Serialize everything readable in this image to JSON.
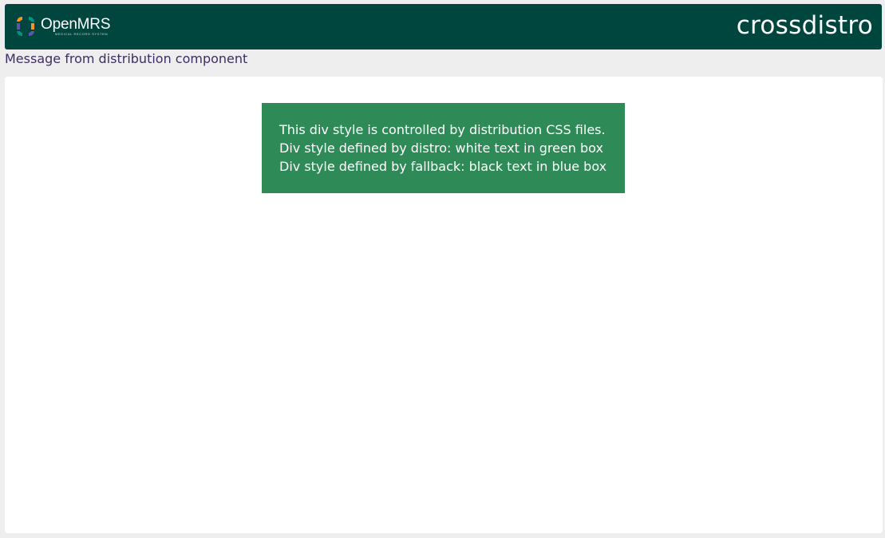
{
  "header": {
    "logo": {
      "icon": "openmrs-logo-icon",
      "name": "OpenMRS",
      "subtitle": "MEDICAL RECORD SYSTEM"
    },
    "title": "crossdistro"
  },
  "message": "Message from distribution component",
  "main": {
    "distro_box": {
      "lines": [
        "This div style is controlled by distribution CSS files.",
        "Div style defined by distro: white text in green box",
        "Div style defined by fallback: black text in blue box"
      ]
    }
  },
  "colors": {
    "header_bg": "#00463f",
    "page_bg": "#eeeeee",
    "panel_bg": "#ffffff",
    "box_bg": "#2e8a57",
    "message_text": "#3d2e63",
    "logo_orange": "#f7931e",
    "logo_green": "#009384",
    "logo_purple": "#5b57a6"
  }
}
